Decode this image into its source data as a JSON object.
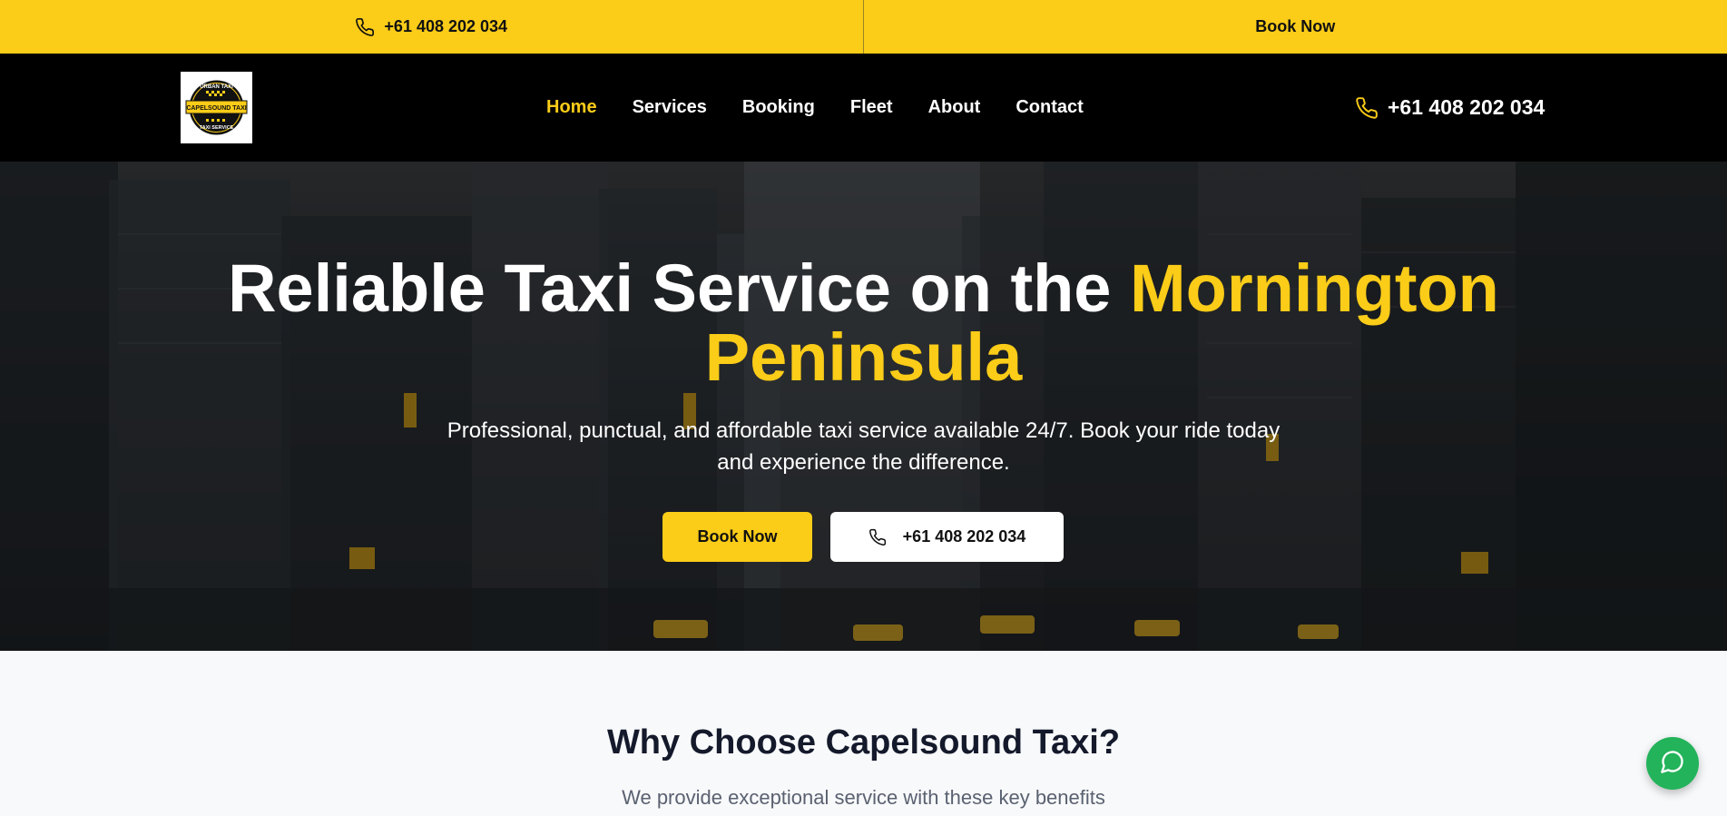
{
  "topbar": {
    "phone": "+61 408 202 034",
    "phone_icon": "phone-icon",
    "book": "Book Now",
    "bg_color": "#fbcc18"
  },
  "nav": {
    "logo_alt": "Capelsound Taxi logo",
    "logo_lines": [
      "URBAN TAXI",
      "CAPELSOUND TAXI",
      "TAXI SERVICE"
    ],
    "items": [
      {
        "label": "Home",
        "active": true
      },
      {
        "label": "Services"
      },
      {
        "label": "Booking"
      },
      {
        "label": "Fleet"
      },
      {
        "label": "About"
      },
      {
        "label": "Contact"
      }
    ],
    "phone": "+61 408 202 034",
    "accent_color": "#fbcc18"
  },
  "hero": {
    "title_plain": "Reliable Taxi Service on the ",
    "title_highlight_1": "Mornington",
    "title_highlight_2": "Peninsula",
    "subtitle": "Professional, punctual, and affordable taxi service available 24/7. Book your ride today and experience the difference.",
    "cta_primary": "Book Now",
    "cta_secondary": "+61 408 202 034"
  },
  "why": {
    "title": "Why Choose Capelsound Taxi?",
    "subtitle": "We provide exceptional service with these key benefits"
  },
  "chat": {
    "icon": "chat-bubble-icon",
    "color": "#23b35a"
  }
}
